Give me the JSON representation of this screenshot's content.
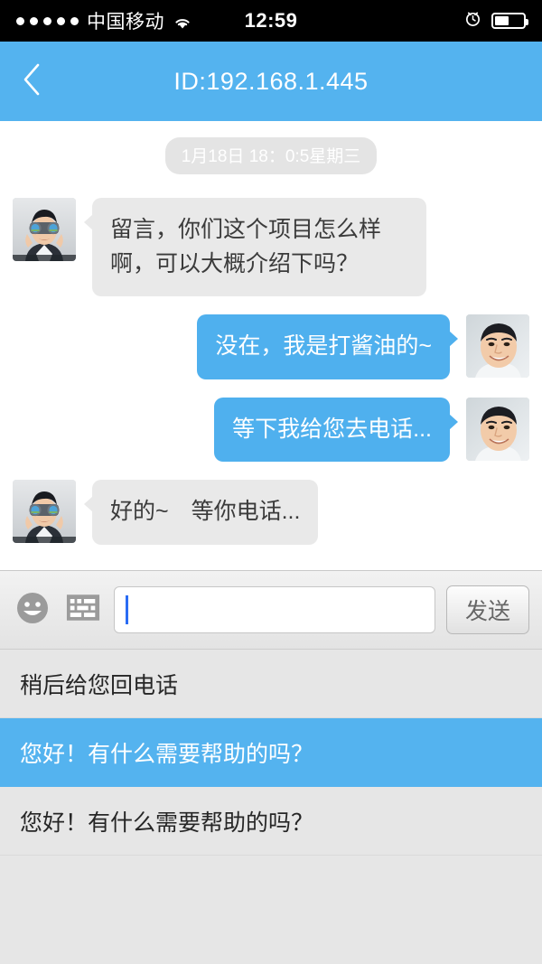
{
  "status_bar": {
    "signal_dots": 5,
    "carrier": "中国移动",
    "wifi_icon": "wifi-icon",
    "time": "12:59",
    "alarm_icon": "alarm-clock-icon",
    "battery_icon": "battery-icon",
    "battery_level_percent": 45
  },
  "header": {
    "back_icon": "chevron-left-icon",
    "title": "ID:192.168.1.445",
    "background_color": "#54b3ef"
  },
  "chat": {
    "timestamp": "1月18日 18：0:5星期三",
    "messages": [
      {
        "side": "left",
        "avatar": "man-with-binoculars-avatar",
        "text": "留言，你们这个项目怎么样啊，可以大概介绍下吗？"
      },
      {
        "side": "right",
        "avatar": "smiling-man-portrait-avatar",
        "text": "没在，我是打酱油的~"
      },
      {
        "side": "right",
        "avatar": "smiling-man-portrait-avatar",
        "text": "等下我给您去电话..."
      },
      {
        "side": "left",
        "avatar": "man-with-binoculars-avatar",
        "text": "好的~　等你电话..."
      }
    ],
    "bubble_colors": {
      "incoming": "#e9e9e9",
      "outgoing": "#4fb0ee"
    }
  },
  "input_bar": {
    "emoji_icon": "smiley-face-icon",
    "keyboard_icon": "keyboard-icon",
    "input_value": "",
    "input_placeholder": "",
    "send_label": "发送"
  },
  "quick_replies": {
    "items": [
      {
        "label": "稍后给您回电话",
        "selected": false
      },
      {
        "label": "您好！有什么需要帮助的吗？",
        "selected": true
      },
      {
        "label": "您好！有什么需要帮助的吗？",
        "selected": false
      },
      {
        "label": "",
        "selected": false
      }
    ],
    "selected_color": "#54b3ef",
    "background_color": "#e6e6e6"
  }
}
